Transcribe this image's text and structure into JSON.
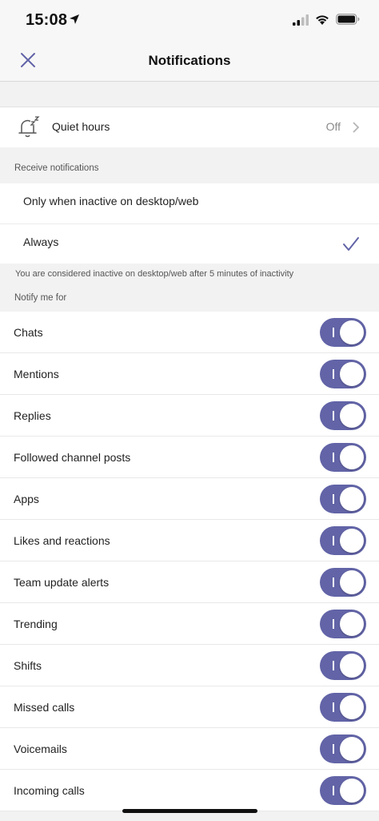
{
  "status_bar": {
    "time": "15:08"
  },
  "nav": {
    "title": "Notifications",
    "close_icon": "close-icon"
  },
  "quiet_hours": {
    "label": "Quiet hours",
    "value": "Off",
    "icon": "bell-sleep-icon"
  },
  "receive": {
    "header": "Receive notifications",
    "options": [
      {
        "label": "Only when inactive on desktop/web",
        "selected": false
      },
      {
        "label": "Always",
        "selected": true
      }
    ],
    "footnote": "You are considered inactive on desktop/web after 5 minutes of inactivity"
  },
  "notify": {
    "header": "Notify me for",
    "items": [
      {
        "label": "Chats",
        "on": true
      },
      {
        "label": "Mentions",
        "on": true
      },
      {
        "label": "Replies",
        "on": true
      },
      {
        "label": "Followed channel posts",
        "on": true
      },
      {
        "label": "Apps",
        "on": true
      },
      {
        "label": "Likes and reactions",
        "on": true
      },
      {
        "label": "Team update alerts",
        "on": true
      },
      {
        "label": "Trending",
        "on": true
      },
      {
        "label": "Shifts",
        "on": true
      },
      {
        "label": "Missed calls",
        "on": true
      },
      {
        "label": "Voicemails",
        "on": true
      },
      {
        "label": "Incoming calls",
        "on": true
      }
    ]
  },
  "colors": {
    "accent": "#6264a7",
    "background": "#f2f2f2"
  }
}
